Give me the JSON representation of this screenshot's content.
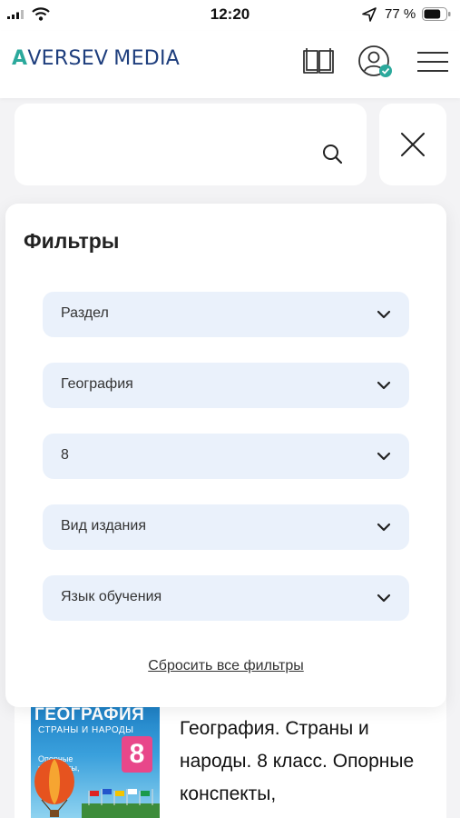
{
  "status_bar": {
    "time": "12:20",
    "battery_percent": "77 %",
    "battery_level": 0.77
  },
  "header": {
    "logo_main": "AVERSEV",
    "logo_first_letter": "A",
    "logo_rest": "VERSEV",
    "logo_media": "MEDIA",
    "accent_color": "#2ba99c",
    "brand_color": "#1e3e7d"
  },
  "search": {
    "value": "",
    "placeholder": ""
  },
  "filters": {
    "title": "Фильтры",
    "selects": [
      {
        "label": "Раздел"
      },
      {
        "label": "География"
      },
      {
        "label": "8"
      },
      {
        "label": "Вид издания"
      },
      {
        "label": "Язык обучения"
      }
    ],
    "reset_label": "Сбросить все фильтры"
  },
  "product": {
    "cover_title": "ГЕОГРАФИЯ",
    "cover_subtitle": "СТРАНЫ И НАРОДЫ",
    "cover_line1": "Опорные",
    "cover_line2": "конспекты,",
    "cover_grade": "8",
    "title": "География. Страны и народы. 8 класс. Опорные конспекты,"
  }
}
